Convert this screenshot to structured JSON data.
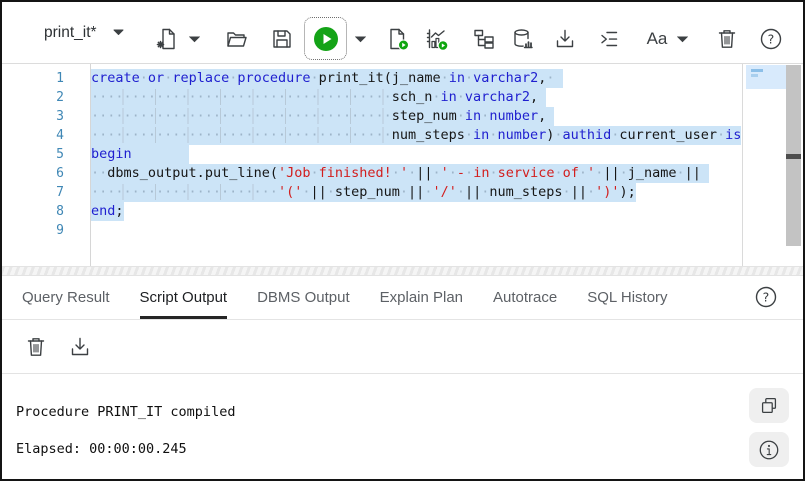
{
  "toolbar": {
    "worksheet_name": "print_it*",
    "font_size_label": "Aa",
    "icons": [
      "worksheet-dropdown",
      "new-worksheet",
      "new-worksheet-dropdown",
      "open-file",
      "save",
      "run-statement",
      "run-statement-dropdown",
      "run-script",
      "autotrace",
      "explain-plan",
      "data-loading",
      "download",
      "format",
      "font-size",
      "font-size-dropdown",
      "clear",
      "help"
    ]
  },
  "editor": {
    "line_numbers": [
      "1",
      "2",
      "3",
      "4",
      "5",
      "6",
      "7",
      "8",
      "9"
    ],
    "lines": [
      {
        "selected": true,
        "tokens": [
          [
            "kw",
            "create"
          ],
          [
            "ws",
            1
          ],
          [
            "kw",
            "or"
          ],
          [
            "ws",
            1
          ],
          [
            "kw",
            "replace"
          ],
          [
            "ws",
            1
          ],
          [
            "kw",
            "procedure"
          ],
          [
            "ws",
            1
          ],
          [
            "id",
            "print_it"
          ],
          [
            "pun",
            "("
          ],
          [
            "id",
            "j_name"
          ],
          [
            "ws",
            1
          ],
          [
            "kw",
            "in"
          ],
          [
            "ws",
            1
          ],
          [
            "kw",
            "varchar2"
          ],
          [
            "pun",
            ","
          ],
          [
            "ws",
            1
          ],
          [
            "sp",
            1
          ]
        ]
      },
      {
        "selected": true,
        "tokens": [
          [
            "lw",
            37
          ],
          [
            "id",
            "sch_n"
          ],
          [
            "ws",
            1
          ],
          [
            "kw",
            "in"
          ],
          [
            "ws",
            1
          ],
          [
            "kw",
            "varchar2"
          ],
          [
            "pun",
            ","
          ],
          [
            "sp",
            1
          ]
        ]
      },
      {
        "selected": true,
        "tokens": [
          [
            "lw",
            37
          ],
          [
            "id",
            "step_num"
          ],
          [
            "ws",
            1
          ],
          [
            "kw",
            "in"
          ],
          [
            "ws",
            1
          ],
          [
            "kw",
            "number"
          ],
          [
            "pun",
            ","
          ],
          [
            "sp",
            1
          ]
        ]
      },
      {
        "selected": true,
        "tokens": [
          [
            "lw",
            37
          ],
          [
            "id",
            "num_steps"
          ],
          [
            "ws",
            1
          ],
          [
            "kw",
            "in"
          ],
          [
            "ws",
            1
          ],
          [
            "kw",
            "number"
          ],
          [
            "pun",
            ")"
          ],
          [
            "ws",
            1
          ],
          [
            "kw",
            "authid"
          ],
          [
            "ws",
            1
          ],
          [
            "id",
            "current_user"
          ],
          [
            "ws",
            1
          ],
          [
            "kw",
            "is"
          ]
        ]
      },
      {
        "selected": true,
        "tokens": [
          [
            "kw",
            "begin"
          ],
          [
            "sp",
            7
          ]
        ]
      },
      {
        "selected": true,
        "tokens": [
          [
            "lw",
            2
          ],
          [
            "id",
            "dbms_output"
          ],
          [
            "pun",
            "."
          ],
          [
            "id",
            "put_line"
          ],
          [
            "pun",
            "("
          ],
          [
            "str",
            "'Job finished! '"
          ],
          [
            "ws",
            1
          ],
          [
            "pun",
            "||"
          ],
          [
            "ws",
            1
          ],
          [
            "str",
            "' - in service of '"
          ],
          [
            "ws",
            1
          ],
          [
            "pun",
            "||"
          ],
          [
            "ws",
            1
          ],
          [
            "id",
            "j_name"
          ],
          [
            "ws",
            1
          ],
          [
            "pun",
            "||"
          ],
          [
            "sp",
            1
          ]
        ]
      },
      {
        "selected": true,
        "tokens": [
          [
            "lw",
            23
          ],
          [
            "str",
            "'('"
          ],
          [
            "ws",
            1
          ],
          [
            "pun",
            "||"
          ],
          [
            "ws",
            1
          ],
          [
            "id",
            "step_num"
          ],
          [
            "ws",
            1
          ],
          [
            "pun",
            "||"
          ],
          [
            "ws",
            1
          ],
          [
            "str",
            "'/'"
          ],
          [
            "ws",
            1
          ],
          [
            "pun",
            "||"
          ],
          [
            "ws",
            1
          ],
          [
            "id",
            "num_steps"
          ],
          [
            "ws",
            1
          ],
          [
            "pun",
            "||"
          ],
          [
            "ws",
            1
          ],
          [
            "str",
            "')'"
          ],
          [
            "pun",
            ");"
          ]
        ]
      },
      {
        "selected": true,
        "tokens": [
          [
            "kw",
            "end"
          ],
          [
            "pun",
            ";"
          ]
        ]
      },
      {
        "selected": false,
        "tokens": []
      }
    ]
  },
  "results": {
    "tabs": [
      {
        "label": "Query Result",
        "active": false
      },
      {
        "label": "Script Output",
        "active": true
      },
      {
        "label": "DBMS Output",
        "active": false
      },
      {
        "label": "Explain Plan",
        "active": false
      },
      {
        "label": "Autotrace",
        "active": false
      },
      {
        "label": "SQL History",
        "active": false
      }
    ],
    "toolbar_icons": [
      "clear-output",
      "download-output"
    ],
    "help_icon": "help"
  },
  "output": {
    "line1": "Procedure PRINT_IT compiled",
    "line2": "Elapsed: 00:00:00.245",
    "buttons": [
      "copy-output",
      "output-info"
    ]
  },
  "colors": {
    "keyword": "#1f1fcf",
    "string": "#d21e1e",
    "selection": "#cce4f7",
    "line_number": "#3f87b5",
    "run_green": "#14a317",
    "badge_green": "#0ea50e"
  }
}
